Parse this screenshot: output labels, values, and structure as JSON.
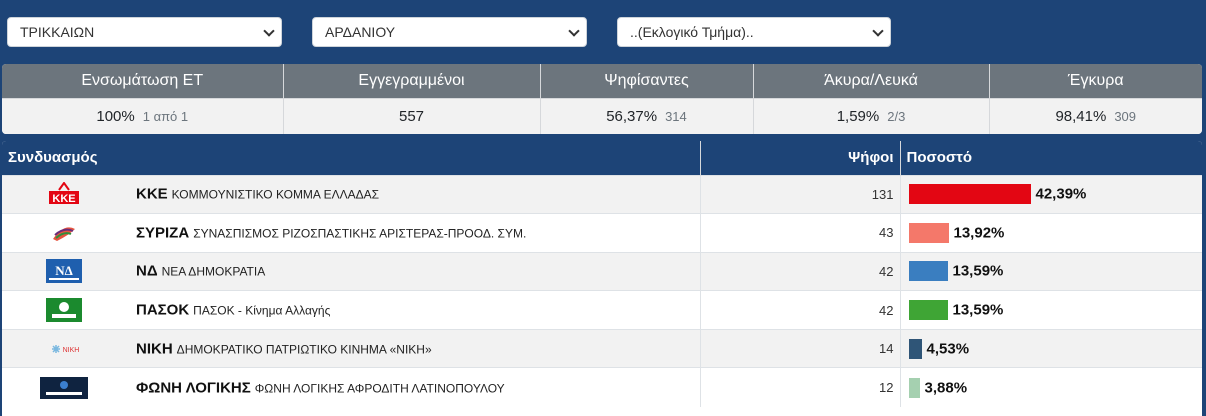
{
  "selects": {
    "nomos": "ΤΡΙΚΚΑΙΩΝ",
    "dimos": "ΑΡΔΑΝΙΟΥ",
    "tmima": "..(Εκλογικό Τμήμα).."
  },
  "summary": {
    "headers": [
      "Ενσωμάτωση ΕΤ",
      "Εγγεγραμμένοι",
      "Ψηφίσαντες",
      "Άκυρα/Λευκά",
      "Έγκυρα"
    ],
    "values": [
      {
        "main": "100%",
        "sub": "1 από 1"
      },
      {
        "main": "557",
        "sub": ""
      },
      {
        "main": "56,37%",
        "sub": "314"
      },
      {
        "main": "1,59%",
        "sub": "2/3"
      },
      {
        "main": "98,41%",
        "sub": "309"
      }
    ]
  },
  "results": {
    "headers": {
      "party": "Συνδυασμός",
      "votes": "Ψήφοι",
      "percent": "Ποσοστό"
    },
    "rows": [
      {
        "short": "ΚΚΕ",
        "full": "ΚΟΜΜΟΥΝΙΣΤΙΚΟ ΚΟΜΜΑ ΕΛΛΑΔΑΣ",
        "votes": "131",
        "percent": "42,39%",
        "share": 42.39,
        "color": "#e30613",
        "logo": "kke-logo-icon"
      },
      {
        "short": "ΣΥΡΙΖΑ",
        "full": "ΣΥΝΑΣΠΙΣΜΟΣ ΡΙΖΟΣΠΑΣΤΙΚΗΣ ΑΡΙΣΤΕΡΑΣ-ΠΡΟΟΔ. ΣΥΜ.",
        "votes": "43",
        "percent": "13,92%",
        "share": 13.92,
        "color": "#f4786a",
        "logo": "syriza-logo-icon"
      },
      {
        "short": "ΝΔ",
        "full": "ΝΕΑ ΔΗΜΟΚΡΑΤΙΑ",
        "votes": "42",
        "percent": "13,59%",
        "share": 13.59,
        "color": "#3a7ec0",
        "logo": "nd-logo-icon"
      },
      {
        "short": "ΠΑΣΟΚ",
        "full": "ΠΑΣΟΚ - Κίνημα Αλλαγής",
        "votes": "42",
        "percent": "13,59%",
        "share": 13.59,
        "color": "#3fa535",
        "logo": "pasok-logo-icon"
      },
      {
        "short": "ΝΙΚΗ",
        "full": "ΔΗΜΟΚΡΑΤΙΚΟ ΠΑΤΡΙΩΤΙΚΟ ΚΙΝΗΜΑ «ΝΙΚΗ»",
        "votes": "14",
        "percent": "4,53%",
        "share": 4.53,
        "color": "#2f5577",
        "logo": "niki-logo-icon"
      },
      {
        "short": "ΦΩΝΗ ΛΟΓΙΚΗΣ",
        "full": "ΦΩΝΗ ΛΟΓΙΚΗΣ ΑΦΡΟΔΙΤΗ ΛΑΤΙΝΟΠΟΥΛΟΥ",
        "votes": "12",
        "percent": "3,88%",
        "share": 3.88,
        "color": "#a5d0b0",
        "logo": "foni-logikis-logo-icon"
      }
    ]
  }
}
